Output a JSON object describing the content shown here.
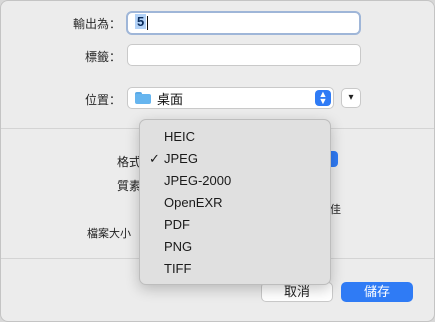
{
  "form": {
    "export_as_label": "輸出為：",
    "export_as_value": "5",
    "tags_label": "標籤：",
    "tags_value": "",
    "location_label": "位置：",
    "location_value": "桌面"
  },
  "options": {
    "format_label": "格式",
    "quality_label": "質素",
    "file_size_label": "檔案大小",
    "trailing_char": "佳"
  },
  "format_menu": {
    "items": [
      {
        "label": "HEIC",
        "checked": false
      },
      {
        "label": "JPEG",
        "checked": true
      },
      {
        "label": "JPEG-2000",
        "checked": false
      },
      {
        "label": "OpenEXR",
        "checked": false
      },
      {
        "label": "PDF",
        "checked": false
      },
      {
        "label": "PNG",
        "checked": false
      },
      {
        "label": "TIFF",
        "checked": false
      }
    ],
    "check_glyph": "✓"
  },
  "buttons": {
    "cancel": "取消",
    "save": "儲存"
  },
  "colors": {
    "accent": "#2f7bf5",
    "selection": "#b3d2f7"
  }
}
